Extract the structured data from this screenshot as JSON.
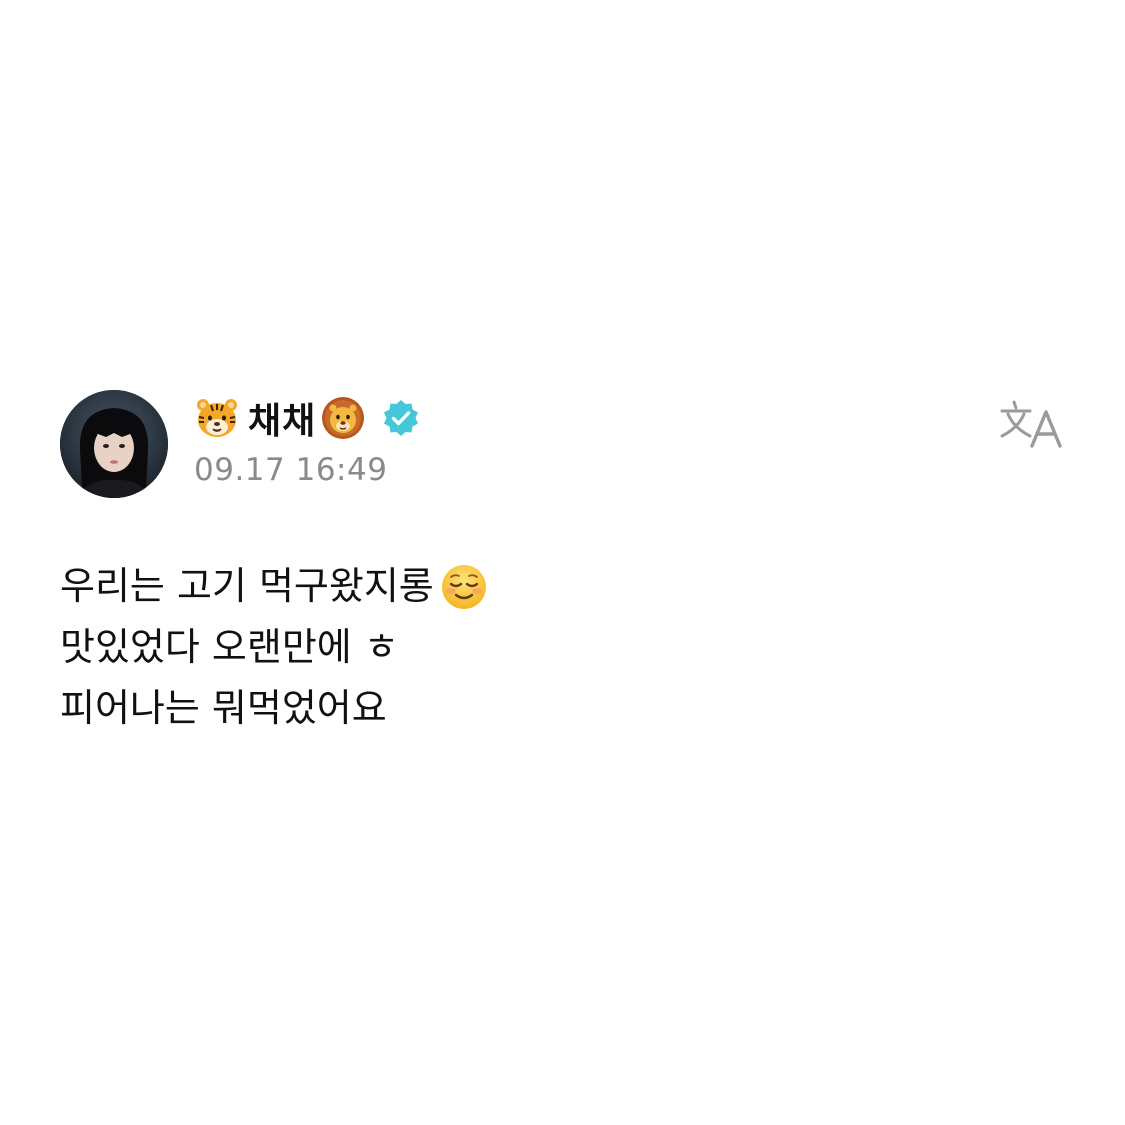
{
  "post": {
    "author": {
      "name": "채채",
      "verified": true,
      "name_prefix_icon": "tiger-face-icon",
      "name_suffix_icon": "lion-face-icon",
      "verified_icon": "verified-badge-icon",
      "verified_color": "#3ec6d8"
    },
    "timestamp": "09.17 16:49",
    "translate_icon": "translate-icon",
    "message": {
      "line1": "우리는 고기 먹구왔지롱",
      "line1_trailing_icon": "smiling-face-icon",
      "line2": "맛있었다 오랜만에 ㅎ",
      "line3": "피어나는 뭐먹었어요"
    }
  },
  "colors": {
    "background": "#ffffff",
    "text": "#111111",
    "timestamp": "#8a8a8a",
    "translate_icon": "#9a9a9a"
  }
}
